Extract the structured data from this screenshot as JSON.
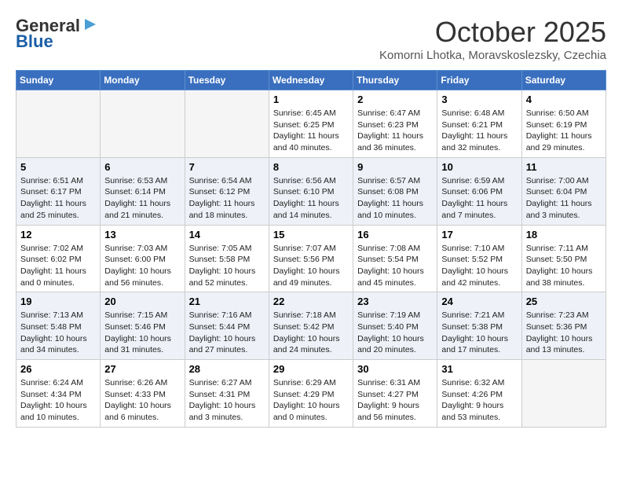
{
  "header": {
    "logo_line1": "General",
    "logo_line2": "Blue",
    "month": "October 2025",
    "location": "Komorni Lhotka, Moravskoslezsky, Czechia"
  },
  "days_of_week": [
    "Sunday",
    "Monday",
    "Tuesday",
    "Wednesday",
    "Thursday",
    "Friday",
    "Saturday"
  ],
  "weeks": [
    [
      {
        "day": "",
        "content": ""
      },
      {
        "day": "",
        "content": ""
      },
      {
        "day": "",
        "content": ""
      },
      {
        "day": "1",
        "content": "Sunrise: 6:45 AM\nSunset: 6:25 PM\nDaylight: 11 hours and 40 minutes."
      },
      {
        "day": "2",
        "content": "Sunrise: 6:47 AM\nSunset: 6:23 PM\nDaylight: 11 hours and 36 minutes."
      },
      {
        "day": "3",
        "content": "Sunrise: 6:48 AM\nSunset: 6:21 PM\nDaylight: 11 hours and 32 minutes."
      },
      {
        "day": "4",
        "content": "Sunrise: 6:50 AM\nSunset: 6:19 PM\nDaylight: 11 hours and 29 minutes."
      }
    ],
    [
      {
        "day": "5",
        "content": "Sunrise: 6:51 AM\nSunset: 6:17 PM\nDaylight: 11 hours and 25 minutes."
      },
      {
        "day": "6",
        "content": "Sunrise: 6:53 AM\nSunset: 6:14 PM\nDaylight: 11 hours and 21 minutes."
      },
      {
        "day": "7",
        "content": "Sunrise: 6:54 AM\nSunset: 6:12 PM\nDaylight: 11 hours and 18 minutes."
      },
      {
        "day": "8",
        "content": "Sunrise: 6:56 AM\nSunset: 6:10 PM\nDaylight: 11 hours and 14 minutes."
      },
      {
        "day": "9",
        "content": "Sunrise: 6:57 AM\nSunset: 6:08 PM\nDaylight: 11 hours and 10 minutes."
      },
      {
        "day": "10",
        "content": "Sunrise: 6:59 AM\nSunset: 6:06 PM\nDaylight: 11 hours and 7 minutes."
      },
      {
        "day": "11",
        "content": "Sunrise: 7:00 AM\nSunset: 6:04 PM\nDaylight: 11 hours and 3 minutes."
      }
    ],
    [
      {
        "day": "12",
        "content": "Sunrise: 7:02 AM\nSunset: 6:02 PM\nDaylight: 11 hours and 0 minutes."
      },
      {
        "day": "13",
        "content": "Sunrise: 7:03 AM\nSunset: 6:00 PM\nDaylight: 10 hours and 56 minutes."
      },
      {
        "day": "14",
        "content": "Sunrise: 7:05 AM\nSunset: 5:58 PM\nDaylight: 10 hours and 52 minutes."
      },
      {
        "day": "15",
        "content": "Sunrise: 7:07 AM\nSunset: 5:56 PM\nDaylight: 10 hours and 49 minutes."
      },
      {
        "day": "16",
        "content": "Sunrise: 7:08 AM\nSunset: 5:54 PM\nDaylight: 10 hours and 45 minutes."
      },
      {
        "day": "17",
        "content": "Sunrise: 7:10 AM\nSunset: 5:52 PM\nDaylight: 10 hours and 42 minutes."
      },
      {
        "day": "18",
        "content": "Sunrise: 7:11 AM\nSunset: 5:50 PM\nDaylight: 10 hours and 38 minutes."
      }
    ],
    [
      {
        "day": "19",
        "content": "Sunrise: 7:13 AM\nSunset: 5:48 PM\nDaylight: 10 hours and 34 minutes."
      },
      {
        "day": "20",
        "content": "Sunrise: 7:15 AM\nSunset: 5:46 PM\nDaylight: 10 hours and 31 minutes."
      },
      {
        "day": "21",
        "content": "Sunrise: 7:16 AM\nSunset: 5:44 PM\nDaylight: 10 hours and 27 minutes."
      },
      {
        "day": "22",
        "content": "Sunrise: 7:18 AM\nSunset: 5:42 PM\nDaylight: 10 hours and 24 minutes."
      },
      {
        "day": "23",
        "content": "Sunrise: 7:19 AM\nSunset: 5:40 PM\nDaylight: 10 hours and 20 minutes."
      },
      {
        "day": "24",
        "content": "Sunrise: 7:21 AM\nSunset: 5:38 PM\nDaylight: 10 hours and 17 minutes."
      },
      {
        "day": "25",
        "content": "Sunrise: 7:23 AM\nSunset: 5:36 PM\nDaylight: 10 hours and 13 minutes."
      }
    ],
    [
      {
        "day": "26",
        "content": "Sunrise: 6:24 AM\nSunset: 4:34 PM\nDaylight: 10 hours and 10 minutes."
      },
      {
        "day": "27",
        "content": "Sunrise: 6:26 AM\nSunset: 4:33 PM\nDaylight: 10 hours and 6 minutes."
      },
      {
        "day": "28",
        "content": "Sunrise: 6:27 AM\nSunset: 4:31 PM\nDaylight: 10 hours and 3 minutes."
      },
      {
        "day": "29",
        "content": "Sunrise: 6:29 AM\nSunset: 4:29 PM\nDaylight: 10 hours and 0 minutes."
      },
      {
        "day": "30",
        "content": "Sunrise: 6:31 AM\nSunset: 4:27 PM\nDaylight: 9 hours and 56 minutes."
      },
      {
        "day": "31",
        "content": "Sunrise: 6:32 AM\nSunset: 4:26 PM\nDaylight: 9 hours and 53 minutes."
      },
      {
        "day": "",
        "content": ""
      }
    ]
  ]
}
